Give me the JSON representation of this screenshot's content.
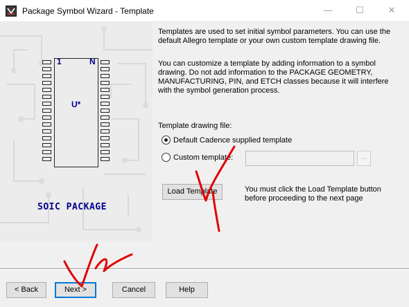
{
  "window": {
    "title": "Package Symbol Wizard - Template",
    "minimize": "—",
    "maximize": "☐",
    "close": "✕"
  },
  "illustration": {
    "pin_first": "1",
    "pin_last": "N",
    "refdes": "U*",
    "package_label": "SOIC PACKAGE"
  },
  "description": {
    "para1": "Templates are used to set initial symbol parameters. You can use the default Allegro template or your own custom template drawing file.",
    "para2": "You can customize a template by adding information to a symbol drawing. Do not add information to the PACKAGE GEOMETRY, MANUFACTURING, PIN, and ETCH classes because it will interfere with the symbol generation process."
  },
  "template": {
    "file_label": "Template drawing file:",
    "default_option": "Default Cadence supplied template",
    "custom_option": "Custom template:",
    "custom_value": "",
    "browse_label": "...",
    "selected": "default",
    "load_button": "Load Template",
    "load_note": "You must click the Load Template button before proceeding to the next page"
  },
  "footer": {
    "back": "< Back",
    "next": "Next >",
    "cancel": "Cancel",
    "help": "Help"
  },
  "colors": {
    "illustration_text": "#00008b",
    "annotation_ink": "#e00000",
    "focus": "#0078d7"
  }
}
